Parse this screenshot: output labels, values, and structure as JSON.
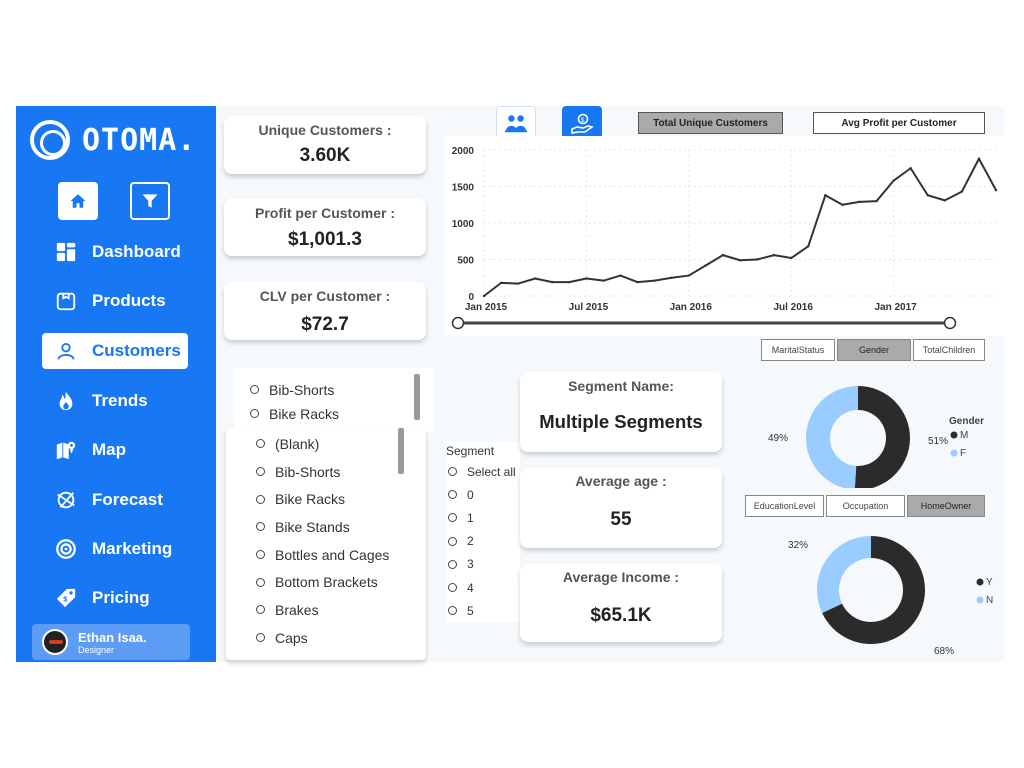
{
  "brand": {
    "name": "OTOMA."
  },
  "nav": [
    {
      "label": "Dashboard",
      "icon": "dashboard-icon"
    },
    {
      "label": "Products",
      "icon": "box-icon"
    },
    {
      "label": "Customers",
      "icon": "user-icon",
      "active": true
    },
    {
      "label": "Trends",
      "icon": "fire-icon"
    },
    {
      "label": "Map",
      "icon": "map-icon"
    },
    {
      "label": "Forecast",
      "icon": "forecast-icon"
    },
    {
      "label": "Marketing",
      "icon": "target-icon"
    },
    {
      "label": "Pricing",
      "icon": "price-tag-icon"
    }
  ],
  "user": {
    "name": "Ethan Isaa.",
    "role": "Designer"
  },
  "kpis": {
    "unique_label": "Unique Customers :",
    "unique_value": "3.60K",
    "profit_label": "Profit per Customer :",
    "profit_value": "$1,001.3",
    "clv_label": "CLV per Customer :",
    "clv_value": "$72.7"
  },
  "chart_toggles": {
    "total": "Total Unique Customers",
    "avg": "Avg Profit per Customer"
  },
  "chart_data": {
    "type": "line",
    "x": [
      "2015-01",
      "2015-02",
      "2015-03",
      "2015-04",
      "2015-05",
      "2015-06",
      "2015-07",
      "2015-08",
      "2015-09",
      "2015-10",
      "2015-11",
      "2015-12",
      "2016-01",
      "2016-02",
      "2016-03",
      "2016-04",
      "2016-05",
      "2016-06",
      "2016-07",
      "2016-08",
      "2016-09",
      "2016-10",
      "2016-11",
      "2016-12",
      "2017-01",
      "2017-02",
      "2017-03",
      "2017-04",
      "2017-05",
      "2017-06",
      "2017-07"
    ],
    "values": [
      0,
      180,
      170,
      240,
      190,
      190,
      240,
      210,
      280,
      190,
      210,
      250,
      280,
      420,
      560,
      490,
      500,
      560,
      520,
      680,
      1380,
      1250,
      1290,
      1300,
      1580,
      1750,
      1380,
      1310,
      1430,
      1880,
      1450
    ],
    "x_ticks": [
      "Jan 2015",
      "Jul 2015",
      "Jan 2016",
      "Jul 2016",
      "Jan 2017"
    ],
    "y_ticks": [
      "0",
      "500",
      "1000",
      "1500",
      "2000"
    ],
    "ylim": [
      0,
      2000
    ],
    "grid": true,
    "color": "#333333"
  },
  "category_list_top": [
    "Bib-Shorts",
    "Bike Racks"
  ],
  "category_list": [
    "(Blank)",
    "Bib-Shorts",
    "Bike Racks",
    "Bike Stands",
    "Bottles and Cages",
    "Bottom Brackets",
    "Brakes",
    "Caps"
  ],
  "segment": {
    "title": "Segment",
    "options": [
      "Select all",
      "0",
      "1",
      "2",
      "3",
      "4",
      "5"
    ]
  },
  "segment_cards": {
    "name_label": "Segment Name:",
    "name_value": "Multiple Segments",
    "age_label": "Average age :",
    "age_value": "55",
    "income_label": "Average Income :",
    "income_value": "$65.1K"
  },
  "demo_buttons_top": [
    "MaritalStatus",
    "Gender",
    "TotalChildren"
  ],
  "demo_buttons_bottom": [
    "EducationLevel",
    "Occupation",
    "HomeOwner"
  ],
  "gender_chart": {
    "type": "pie",
    "legend_title": "Gender",
    "labels": [
      "M",
      "F"
    ],
    "values": [
      51,
      49
    ],
    "pct_labels": [
      "51%",
      "49%"
    ],
    "colors": [
      "#2b2b2b",
      "#99ccff"
    ]
  },
  "homeowner_chart": {
    "type": "pie",
    "labels": [
      "Y",
      "N"
    ],
    "values": [
      68,
      32
    ],
    "pct_labels": [
      "68%",
      "32%"
    ],
    "colors": [
      "#2b2b2b",
      "#99ccff"
    ]
  }
}
